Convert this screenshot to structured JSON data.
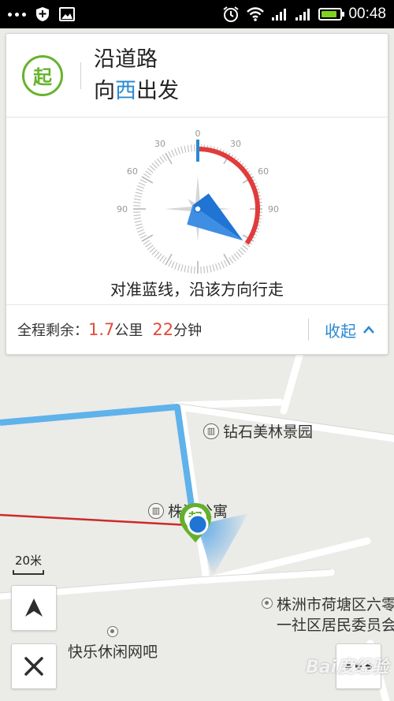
{
  "status_bar": {
    "time": "00:48",
    "icons": [
      "more-dots-icon",
      "shield-plus-icon",
      "image-icon",
      "alarm-icon",
      "wifi-icon",
      "signal-icon",
      "signal-icon",
      "battery-icon"
    ],
    "battery_level": 0.85
  },
  "guidance": {
    "start_badge": "起",
    "line1": "沿道路",
    "line2_prefix": "向",
    "line2_direction": "西",
    "line2_suffix": "出发",
    "compass": {
      "tick_labels": [
        "0",
        "30",
        "30",
        "60",
        "60",
        "90",
        "90"
      ],
      "target_heading_deg": 0,
      "current_heading_deg": 125,
      "colors": {
        "target_line": "#2a8ad3",
        "deviation_arc": "#e03c3c",
        "needle": "#1f74d4"
      }
    },
    "hint": "对准蓝线，沿该方向行走",
    "remaining_label": "全程剩余：",
    "distance_value": "1.7",
    "distance_unit": "公里",
    "time_value": "22",
    "time_unit": "分钟",
    "collapse_label": "收起"
  },
  "map": {
    "pois": [
      {
        "name": "钻石美林景园",
        "icon": "building-icon"
      },
      {
        "name": "株洲公寓",
        "icon": "building-icon"
      },
      {
        "name": "株洲市荷塘区六零",
        "name_line2": "一社区居民委员会",
        "icon": "location-dot-icon"
      },
      {
        "name": "快乐休闲网吧",
        "icon": "location-dot-icon"
      }
    ],
    "start_marker": "起",
    "scale_label": "20米",
    "colors": {
      "route": "#5fb2ea",
      "red_line": "#cc2a2a",
      "road": "#ffffff"
    }
  },
  "controls": {
    "compass_button": "compass-mode-button",
    "close_button": "close-button",
    "more_button": "more-button"
  },
  "watermark": "Bai度经验"
}
